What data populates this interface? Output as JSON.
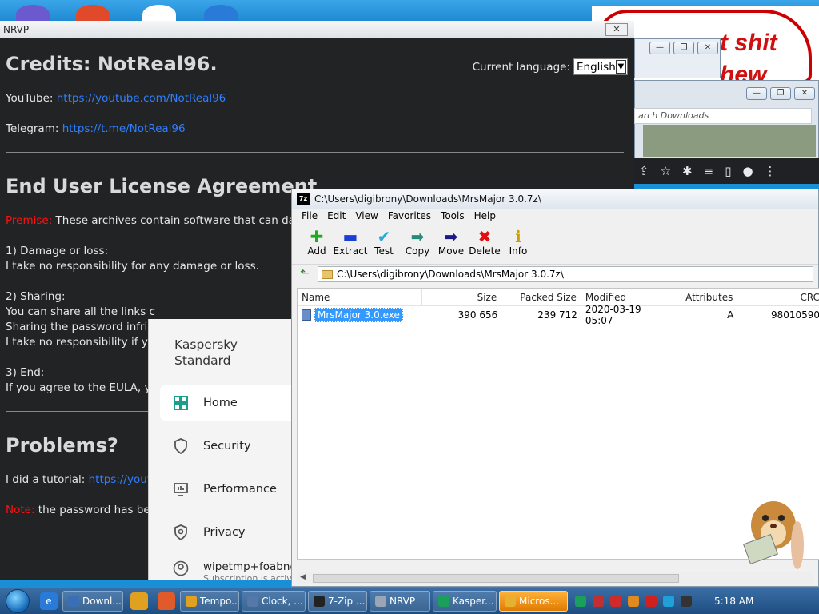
{
  "background": {
    "paint_text": "t shit\nhew",
    "browser_search_placeholder": "arch Downloads",
    "window_buttons": [
      "—",
      "❐",
      "✕"
    ]
  },
  "nrvp": {
    "title": "NRVP",
    "close_glyph": "✕",
    "language_label": "Current language:",
    "language_value": "English",
    "credits_title": "Credits: NotReal96.",
    "youtube_label": "YouTube:",
    "youtube_link": "https://youtube.com/NotReal96",
    "telegram_label": "Telegram:",
    "telegram_link": "https://t.me/NotReal96",
    "eula_title": "End User License Agreement",
    "premise_label": "Premise:",
    "premise_text": " These archives contain software that can dan",
    "damage_title": "1) Damage or loss:",
    "damage_text": "I take no responsibility for any damage or loss.",
    "sharing_title": "2) Sharing:",
    "sharing_line1": "You can share all the links c",
    "sharing_line2": "Sharing the password infring",
    "sharing_line3": "I take no responsibility if yo",
    "end_title": "3) End:",
    "end_text": "If you agree to the EULA, yo",
    "problems_title": "Problems?",
    "tutorial_text": "I did a tutorial: ",
    "tutorial_link": "https://youtu",
    "note_label": "Note:",
    "note_text": " the password has bee"
  },
  "kaspersky": {
    "title": "Kaspersky Standard",
    "nav": [
      {
        "label": "Home",
        "icon": "home-grid-icon"
      },
      {
        "label": "Security",
        "icon": "shield-icon"
      },
      {
        "label": "Performance",
        "icon": "performance-icon"
      },
      {
        "label": "Privacy",
        "icon": "privacy-shield-icon"
      }
    ],
    "account_email": "wipetmp+foabn@",
    "account_sub": "Subscription is active"
  },
  "zip": {
    "title": "C:\\Users\\digibrony\\Downloads\\MrsMajor 3.0.7z\\",
    "menu": [
      "File",
      "Edit",
      "View",
      "Favorites",
      "Tools",
      "Help"
    ],
    "toolbar": [
      {
        "label": "Add",
        "icon": "plus-icon",
        "glyph": "✚",
        "color": "#1faa1f"
      },
      {
        "label": "Extract",
        "icon": "minus-icon",
        "glyph": "▬",
        "color": "#1a3fd6"
      },
      {
        "label": "Test",
        "icon": "checkmark-icon",
        "glyph": "✔",
        "color": "#2aa7d8"
      },
      {
        "label": "Copy",
        "icon": "copy-arrow-icon",
        "glyph": "➡",
        "color": "#2a8a7a"
      },
      {
        "label": "Move",
        "icon": "move-arrow-icon",
        "glyph": "➡",
        "color": "#1a1a8a"
      },
      {
        "label": "Delete",
        "icon": "delete-x-icon",
        "glyph": "✖",
        "color": "#e01010"
      },
      {
        "label": "Info",
        "icon": "info-icon",
        "glyph": "ℹ",
        "color": "#c8a000"
      }
    ],
    "address": "C:\\Users\\digibrony\\Downloads\\MrsMajor 3.0.7z\\",
    "columns": [
      "Name",
      "Size",
      "Packed Size",
      "Modified",
      "Attributes",
      "CRC"
    ],
    "rows": [
      {
        "name": "MrsMajor 3.0.exe",
        "size": "390 656",
        "packed": "239 712",
        "modified": "2020-03-19 05:07",
        "attributes": "A",
        "crc": "98010590"
      }
    ]
  },
  "taskbar": {
    "tasks": [
      {
        "label": "Downl...",
        "color": "#3b6fb5"
      },
      {
        "label": "Tempo...",
        "color": "#e0a020"
      },
      {
        "label": "Clock, ...",
        "color": "#5577aa"
      },
      {
        "label": "7-Zip ...",
        "color": "#222222"
      },
      {
        "label": "NRVP",
        "color": "#9aa6b5"
      },
      {
        "label": "Kasper...",
        "color": "#1aa05a"
      },
      {
        "label": "Micros...",
        "color": "#e8b030"
      }
    ],
    "clock": "5:18 AM"
  }
}
